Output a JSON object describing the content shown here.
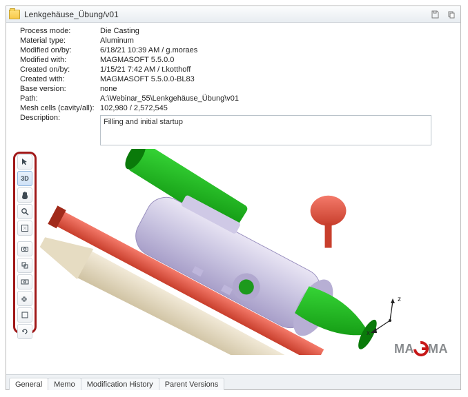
{
  "titlebar": {
    "title": "Lenkgehäuse_Übung/v01"
  },
  "props": {
    "process_mode_label": "Process mode:",
    "process_mode": "Die Casting",
    "material_type_label": "Material type:",
    "material_type": "Aluminum",
    "modified_onby_label": "Modified on/by:",
    "modified_onby": "6/18/21 10:39 AM / g.moraes",
    "modified_with_label": "Modified with:",
    "modified_with": "MAGMASOFT 5.5.0.0",
    "created_onby_label": "Created on/by:",
    "created_onby": "1/15/21 7:42 AM / t.kotthoff",
    "created_with_label": "Created with:",
    "created_with": "MAGMASOFT 5.5.0.0-BL83",
    "base_version_label": "Base version:",
    "base_version": "none",
    "path_label": "Path:",
    "path": "A:\\Webinar_55\\Lenkgehäuse_Übung\\v01",
    "mesh_cells_label": "Mesh cells (cavity/all):",
    "mesh_cells": "102,980 / 2,572,545",
    "description_label": "Description:",
    "description": "Filling and initial startup"
  },
  "toolbar": {
    "items": [
      {
        "name": "pointer-icon",
        "active": false
      },
      {
        "name": "rotate-3d-icon",
        "active": true,
        "text": "3D"
      },
      {
        "name": "pan-hand-icon",
        "active": false
      },
      {
        "name": "zoom-icon",
        "active": false
      },
      {
        "name": "fit-view-icon",
        "active": false,
        "sep_after": true
      },
      {
        "name": "camera-view-icon",
        "active": false
      },
      {
        "name": "parallel-view-icon",
        "active": false
      },
      {
        "name": "perspective-view-icon",
        "active": false
      },
      {
        "name": "section-icon",
        "active": false
      },
      {
        "name": "wireframe-icon",
        "active": false
      },
      {
        "name": "reset-icon",
        "active": false
      }
    ]
  },
  "axis": {
    "z": "z",
    "x": "x"
  },
  "logo": {
    "pre": "MA",
    "post": "MA"
  },
  "tabs": {
    "items": [
      {
        "label": "General",
        "active": true
      },
      {
        "label": "Memo",
        "active": false
      },
      {
        "label": "Modification History",
        "active": false
      },
      {
        "label": "Parent Versions",
        "active": false
      }
    ]
  }
}
